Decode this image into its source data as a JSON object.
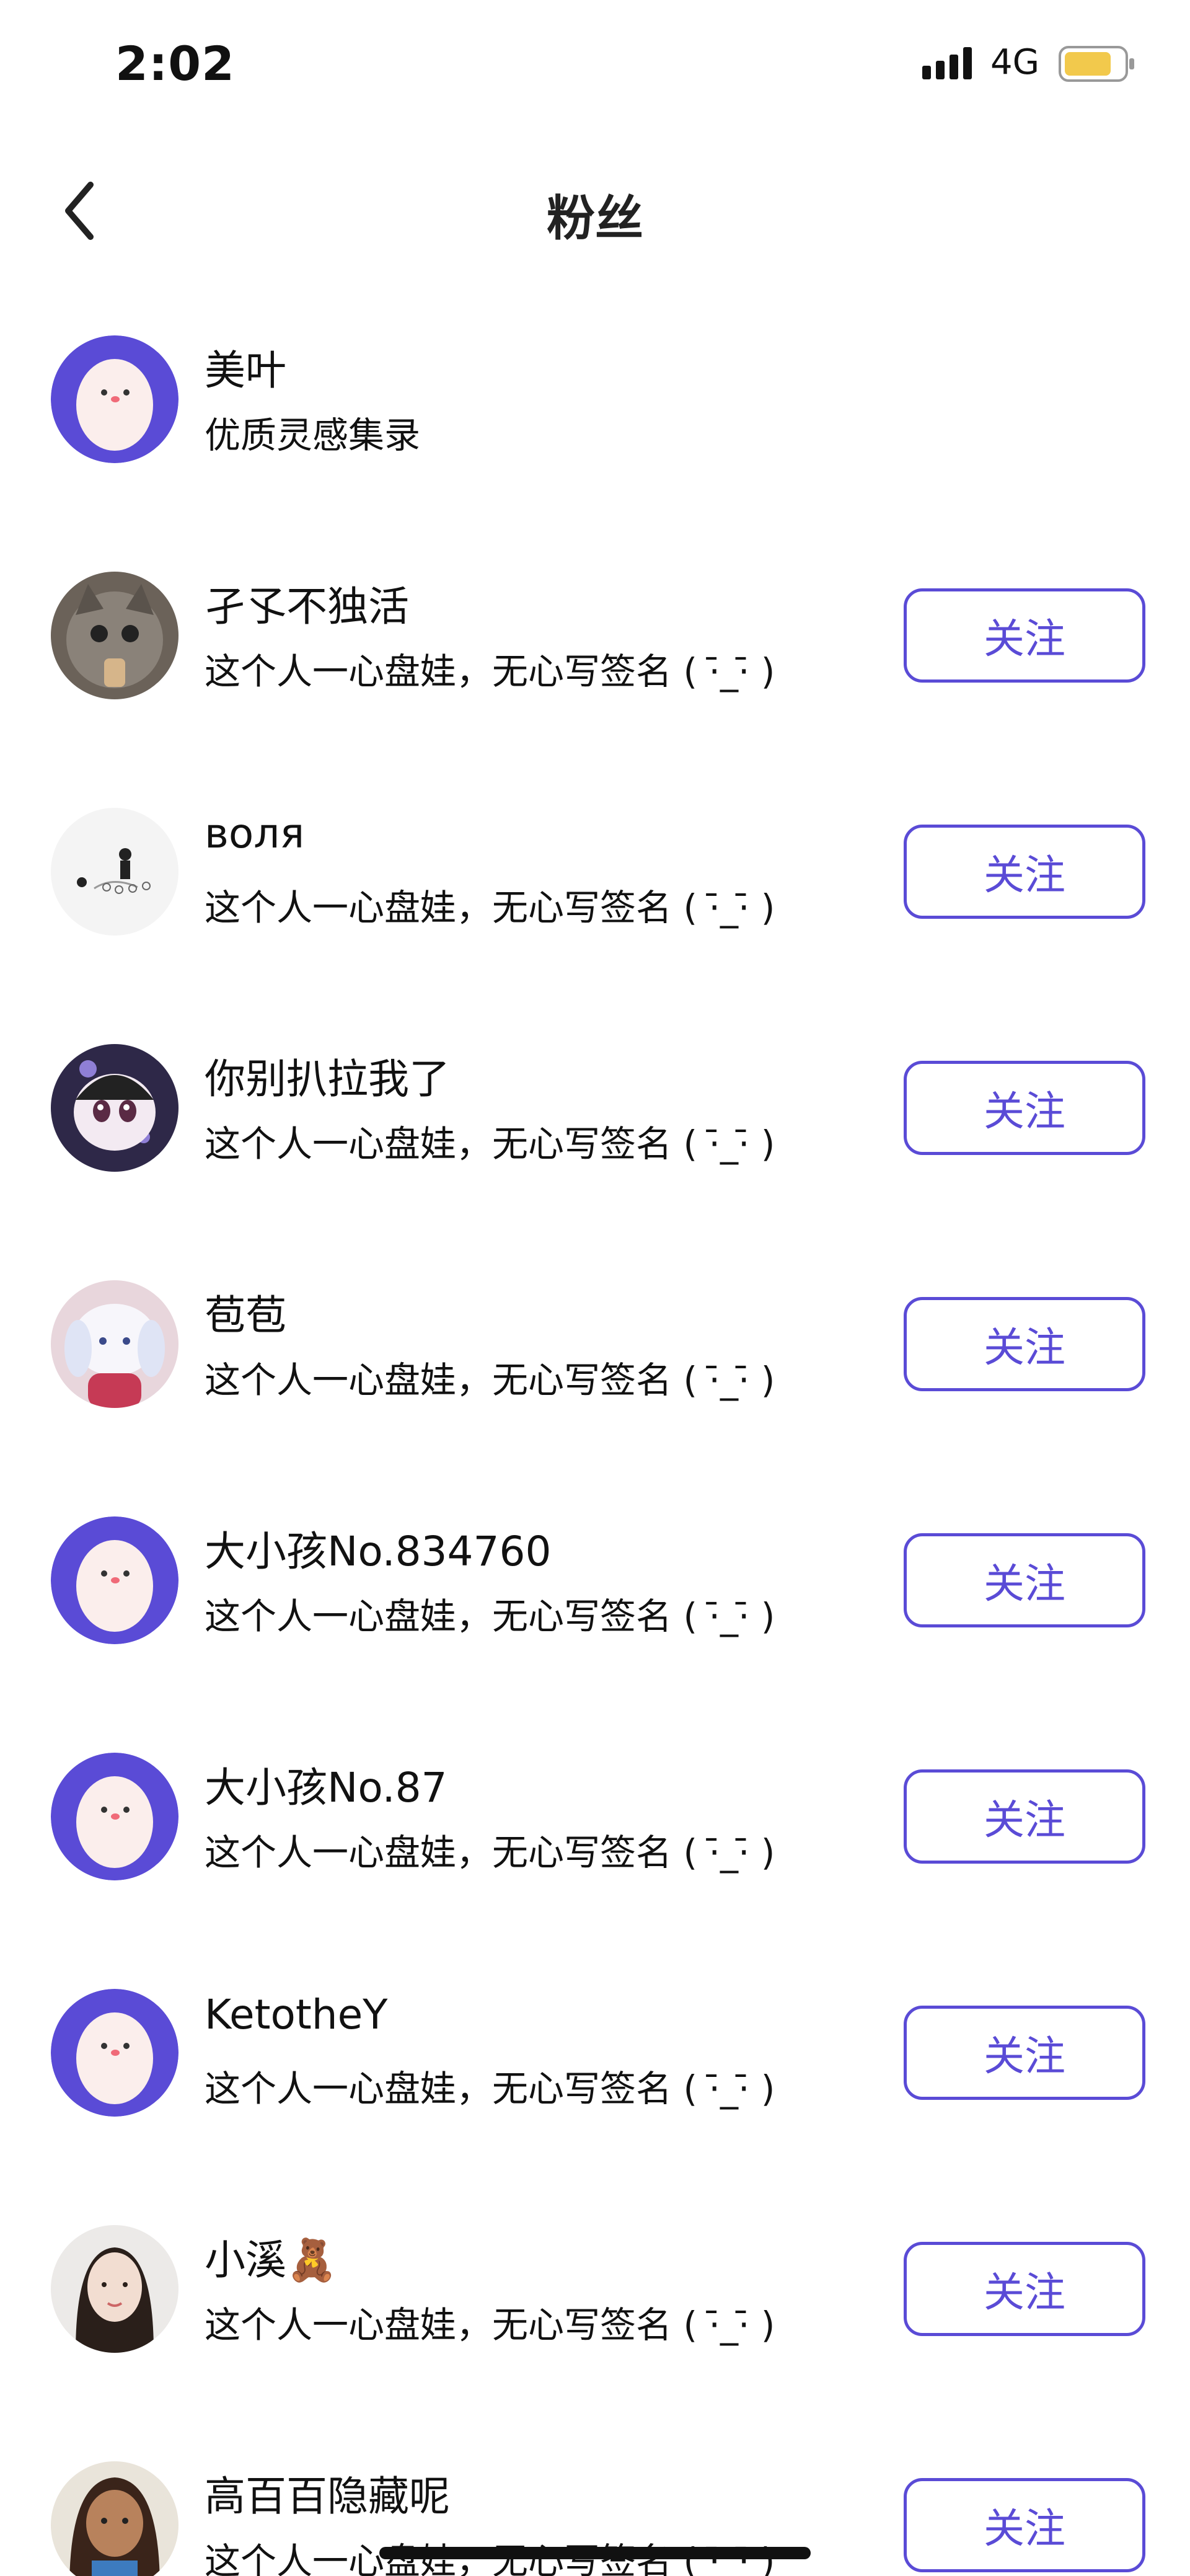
{
  "status_bar": {
    "time": "2:02",
    "network": "4G",
    "signal_icon": "signal-bars-icon",
    "battery_icon": "battery-icon",
    "battery_color": "#f2c94c"
  },
  "nav": {
    "title": "粉丝",
    "back_icon": "chevron-left-icon"
  },
  "accent_color": "#5a4bd6",
  "followers": [
    {
      "name": "美叶",
      "bio": "优质灵感集录",
      "avatar": "egg-mascot",
      "follow_label": ""
    },
    {
      "name": "孑孓不独活",
      "bio": "这个人一心盘娃，无心写签名 ( ·̄_·̄ )",
      "avatar": "cat-photo",
      "follow_label": "关注"
    },
    {
      "name": "воля",
      "bio": "这个人一心盘娃，无心写签名 ( ·̄_·̄ )",
      "avatar": "sketch-figure",
      "follow_label": "关注"
    },
    {
      "name": "你别扒拉我了",
      "bio": "这个人一心盘娃，无心写签名 ( ·̄_·̄ )",
      "avatar": "kuromi-character",
      "follow_label": "关注"
    },
    {
      "name": "苞苞",
      "bio": "这个人一心盘娃，无心写签名 ( ·̄_·̄ )",
      "avatar": "plush-doll",
      "follow_label": "关注"
    },
    {
      "name": "大小孩No.834760",
      "bio": "这个人一心盘娃，无心写签名 ( ·̄_·̄ )",
      "avatar": "egg-mascot",
      "follow_label": "关注"
    },
    {
      "name": "大小孩No.87",
      "bio": "这个人一心盘娃，无心写签名 ( ·̄_·̄ )",
      "avatar": "egg-mascot",
      "follow_label": "关注"
    },
    {
      "name": "KetotheY",
      "bio": "这个人一心盘娃，无心写签名 ( ·̄_·̄ )",
      "avatar": "egg-mascot",
      "follow_label": "关注"
    },
    {
      "name": "小溪🧸",
      "bio": "这个人一心盘娃，无心写签名 ( ·̄_·̄ )",
      "avatar": "woman-portrait",
      "follow_label": "关注"
    },
    {
      "name": "高百百隐藏呢",
      "bio": "这个人一心盘娃，无心写签名 ( ·̄_·̄ )",
      "avatar": "cartoon-girl",
      "follow_label": "关注"
    }
  ]
}
